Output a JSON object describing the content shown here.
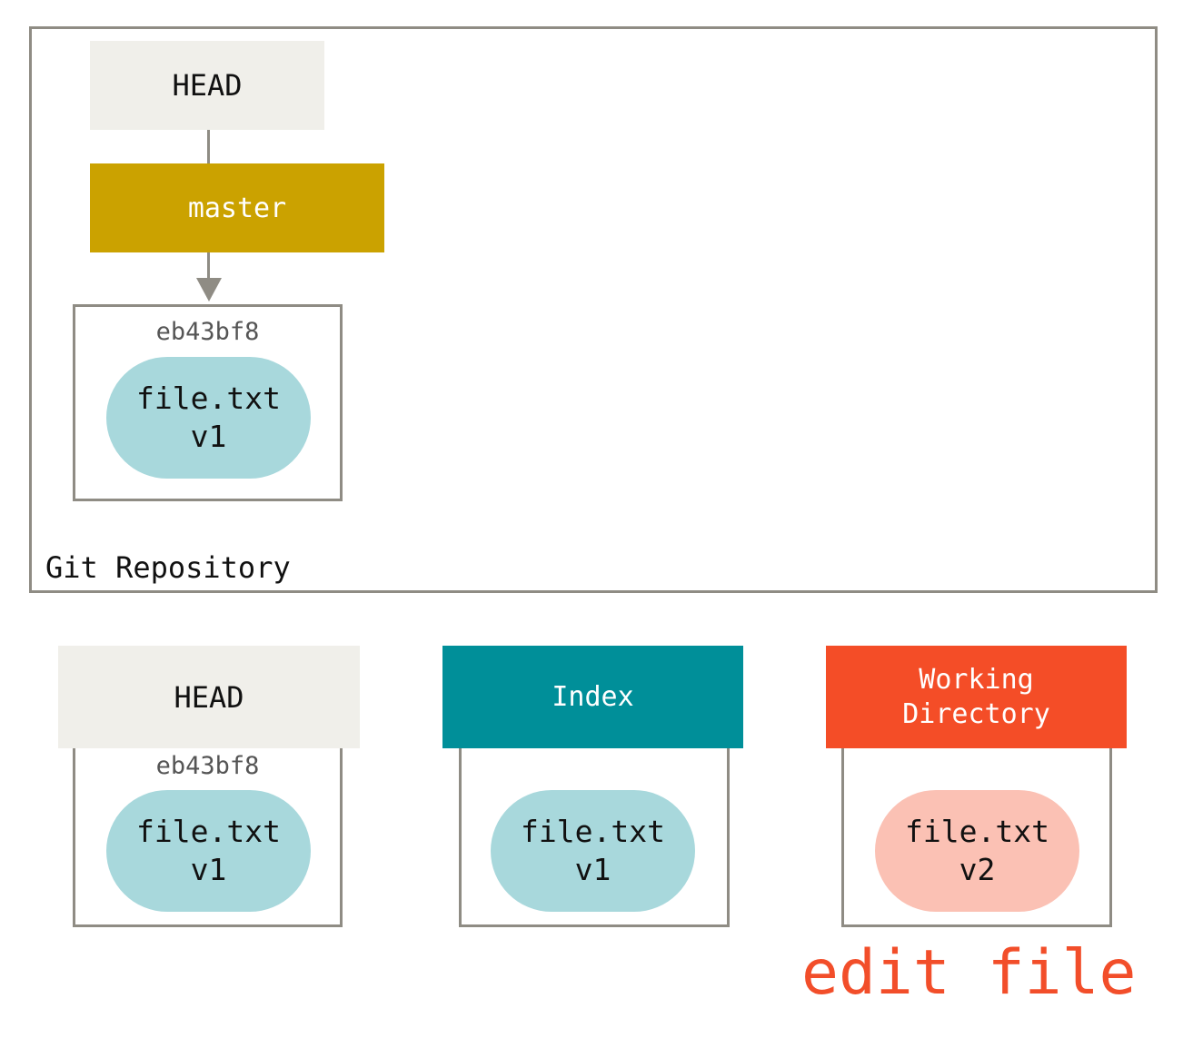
{
  "repository": {
    "label": "Git Repository",
    "head_label": "HEAD",
    "branch_label": "master",
    "commit": {
      "hash": "eb43bf8",
      "file": "file.txt",
      "version": "v1"
    }
  },
  "trees": {
    "head": {
      "label": "HEAD",
      "hash": "eb43bf8",
      "file": "file.txt",
      "version": "v1"
    },
    "index": {
      "label": "Index",
      "file": "file.txt",
      "version": "v1"
    },
    "working_directory": {
      "label_line1": "Working",
      "label_line2": "Directory",
      "file": "file.txt",
      "version": "v2"
    }
  },
  "annotation": "edit file",
  "colors": {
    "head": "#f0efea",
    "branch": "#cba200",
    "index": "#008f99",
    "working_directory": "#f44d27",
    "blob": "#a8d8dc",
    "blob_modified": "#fbc1b4",
    "annotation": "#f24e2a",
    "border": "#8f8c84"
  }
}
